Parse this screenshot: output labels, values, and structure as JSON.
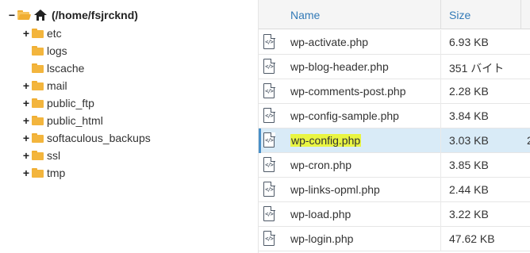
{
  "tree": {
    "root": {
      "label": "(/home/fsjrcknd)",
      "toggle": "−",
      "icon": "home-icon"
    },
    "items": [
      {
        "label": "etc",
        "toggle": "+"
      },
      {
        "label": "logs",
        "toggle": ""
      },
      {
        "label": "lscache",
        "toggle": ""
      },
      {
        "label": "mail",
        "toggle": "+"
      },
      {
        "label": "public_ftp",
        "toggle": "+"
      },
      {
        "label": "public_html",
        "toggle": "+"
      },
      {
        "label": "softaculous_backups",
        "toggle": "+"
      },
      {
        "label": "ssl",
        "toggle": "+"
      },
      {
        "label": "tmp",
        "toggle": "+"
      }
    ]
  },
  "file_list": {
    "columns": {
      "name": "Name",
      "size": "Size"
    },
    "rows": [
      {
        "name": "wp-activate.php",
        "size": "6.93 KB",
        "icon": "php-file-icon"
      },
      {
        "name": "wp-blog-header.php",
        "size": "351 バイト",
        "icon": "php-file-icon"
      },
      {
        "name": "wp-comments-post.php",
        "size": "2.28 KB",
        "icon": "php-file-icon"
      },
      {
        "name": "wp-config-sample.php",
        "size": "3.84 KB",
        "icon": "php-file-icon"
      },
      {
        "name": "wp-config.php",
        "size": "3.03 KB",
        "icon": "php-file-icon",
        "selected": true,
        "extra": "2"
      },
      {
        "name": "wp-cron.php",
        "size": "3.85 KB",
        "icon": "php-file-icon"
      },
      {
        "name": "wp-links-opml.php",
        "size": "2.44 KB",
        "icon": "php-file-icon"
      },
      {
        "name": "wp-load.php",
        "size": "3.22 KB",
        "icon": "php-file-icon"
      },
      {
        "name": "wp-login.php",
        "size": "47.62 KB",
        "icon": "php-file-icon"
      }
    ],
    "icon_glyph": "</>"
  },
  "colors": {
    "header_link": "#337ab7",
    "selected_row": "#d9ebf7",
    "highlight": "#e9f542",
    "folder": "#f3b53d"
  }
}
